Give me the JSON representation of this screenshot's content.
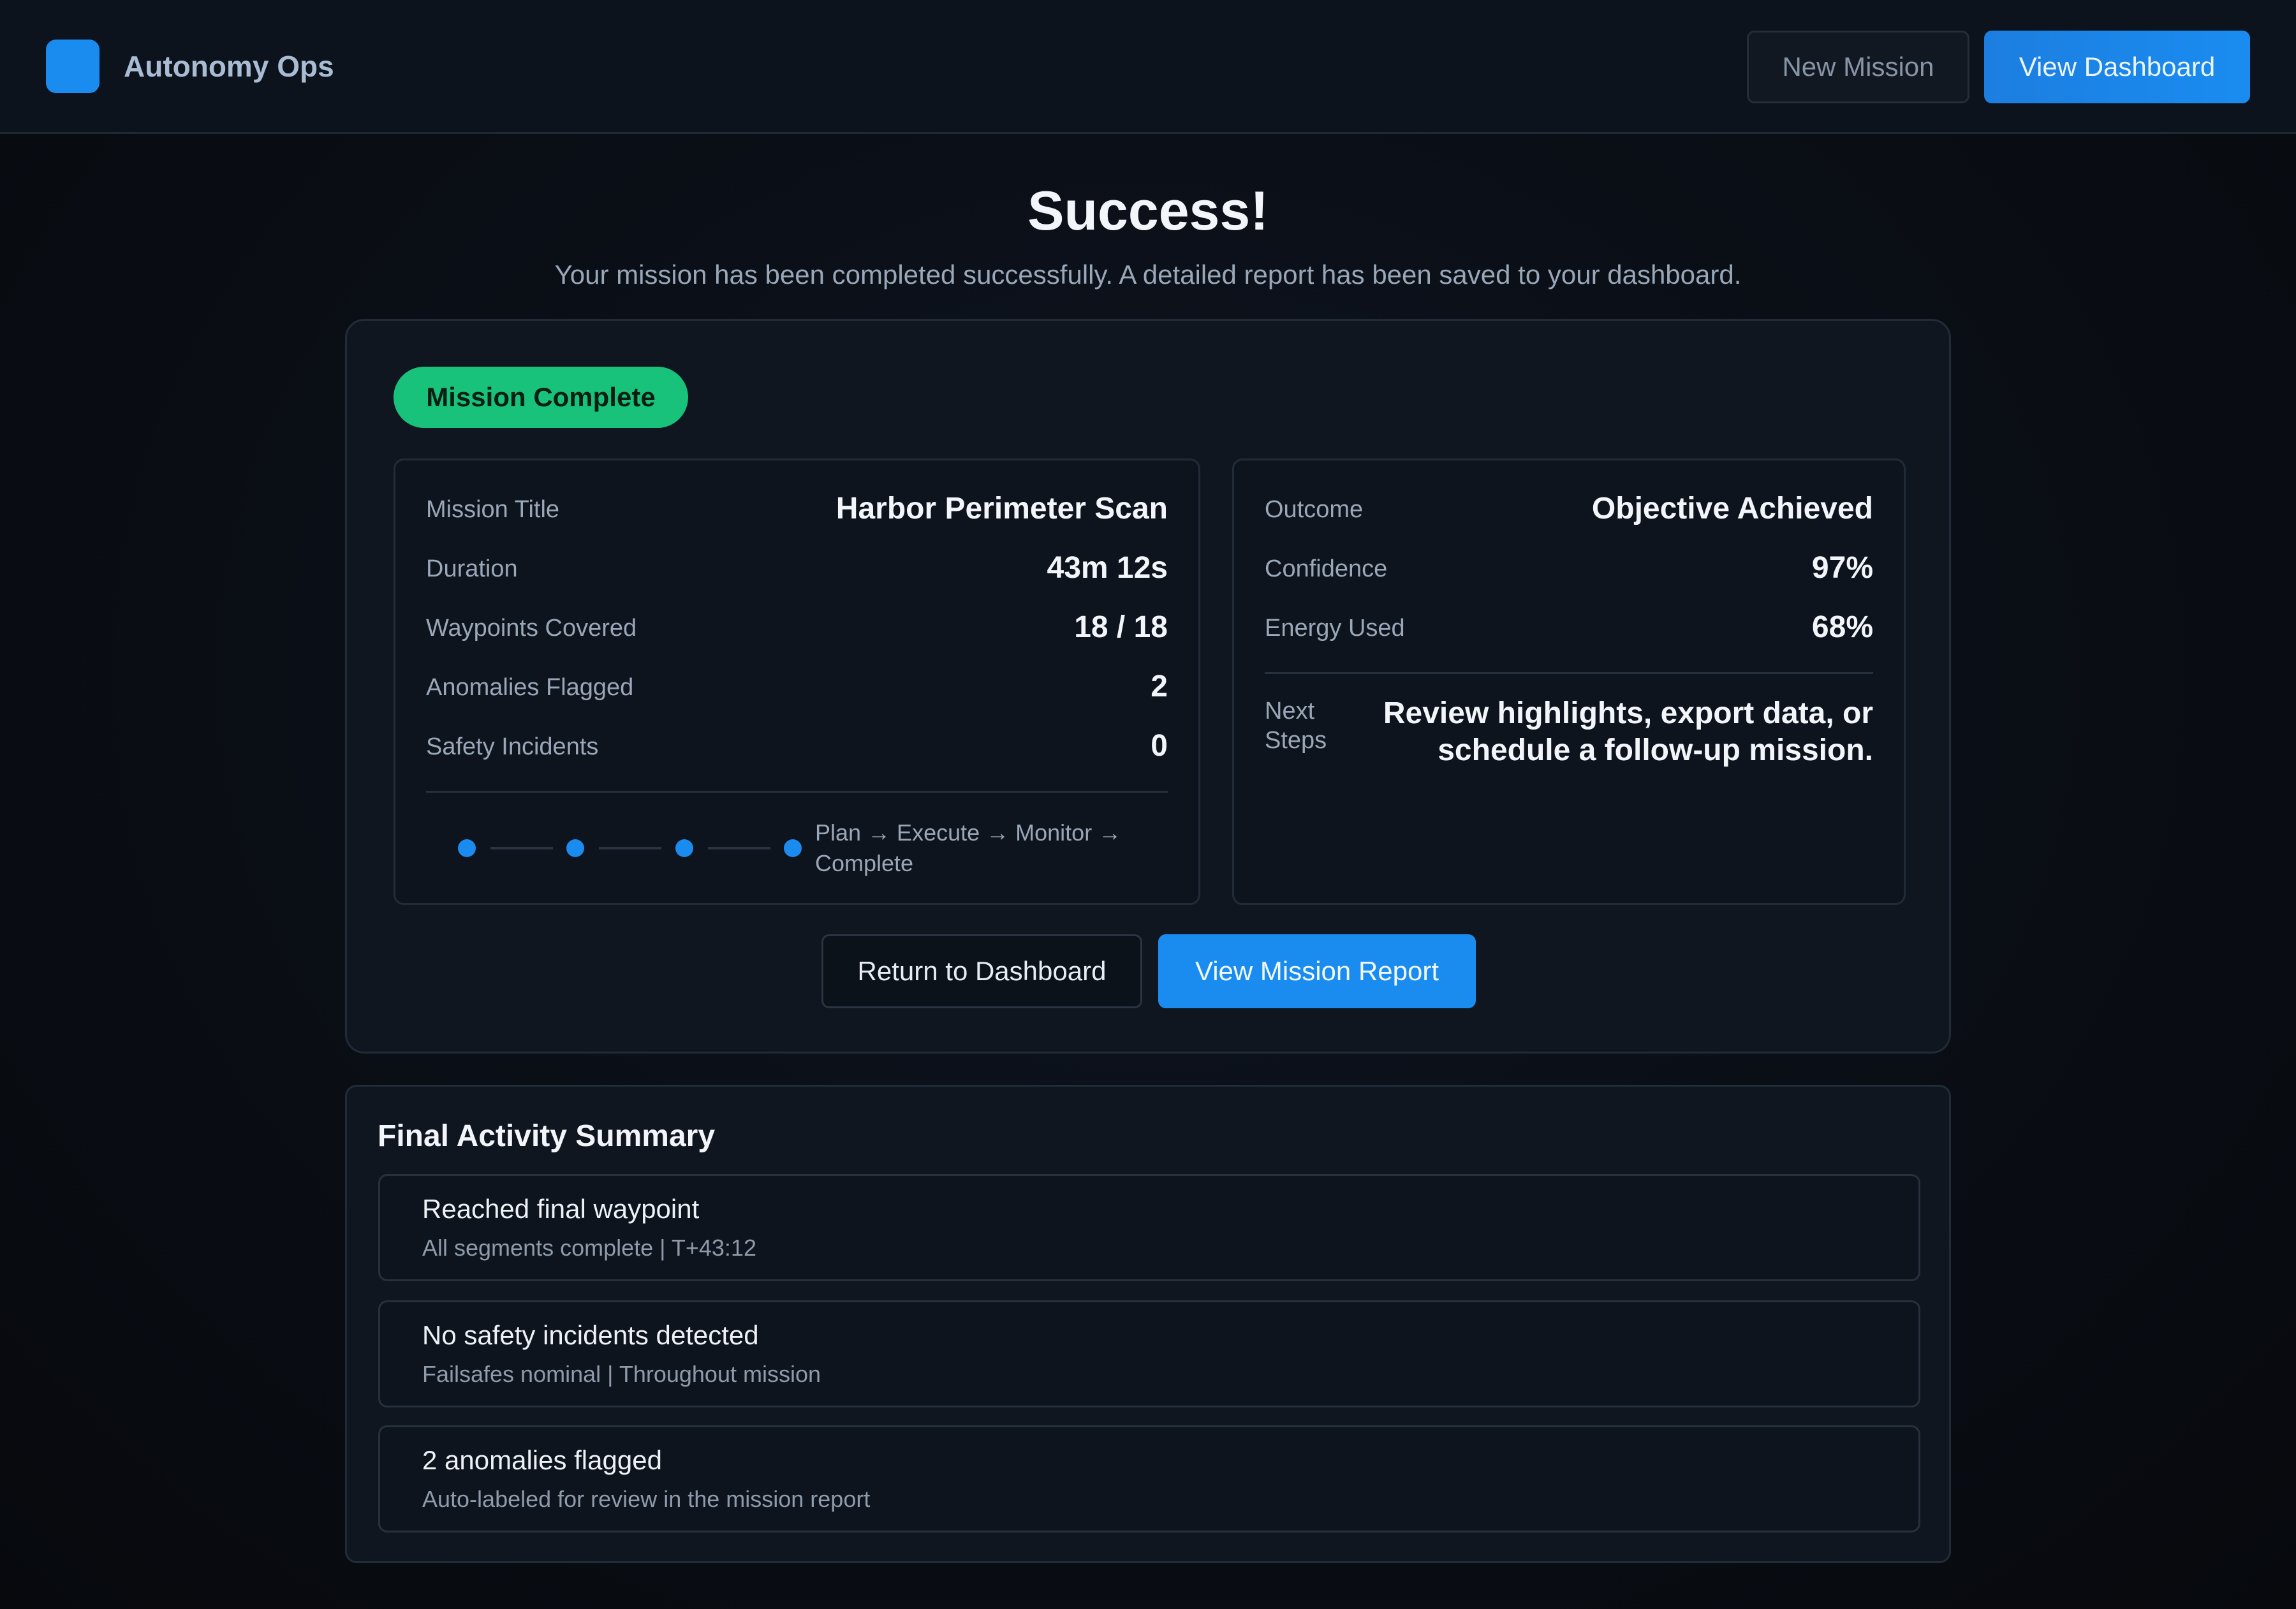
{
  "header": {
    "brand_name": "Autonomy Ops",
    "new_mission_label": "New Mission",
    "view_dashboard_label": "View Dashboard"
  },
  "hero": {
    "title": "Success!",
    "subtitle": "Your mission has been completed successfully. A detailed report has been saved to your dashboard."
  },
  "status": {
    "badge": "Mission Complete"
  },
  "mission": {
    "rows": [
      {
        "label": "Mission Title",
        "value": "Harbor Perimeter Scan"
      },
      {
        "label": "Duration",
        "value": "43m 12s"
      },
      {
        "label": "Waypoints Covered",
        "value": "18 / 18"
      },
      {
        "label": "Anomalies Flagged",
        "value": "2"
      },
      {
        "label": "Safety Incidents",
        "value": "0"
      }
    ],
    "stepper_text": "Plan → Execute → Monitor → Complete"
  },
  "outcome": {
    "rows": [
      {
        "label": "Outcome",
        "value": "Objective Achieved"
      },
      {
        "label": "Confidence",
        "value": "97%"
      },
      {
        "label": "Energy Used",
        "value": "68%"
      }
    ],
    "next_steps_label": "Next Steps",
    "next_steps_value": "Review highlights, export data, or schedule a follow-up mission."
  },
  "actions": {
    "return_label": "Return to Dashboard",
    "report_label": "View Mission Report"
  },
  "activity": {
    "title": "Final Activity Summary",
    "items": [
      {
        "title": "Reached final waypoint",
        "sub": "All segments complete | T+43:12"
      },
      {
        "title": "No safety incidents detected",
        "sub": "Failsafes nominal | Throughout mission"
      },
      {
        "title": "2 anomalies flagged",
        "sub": "Auto-labeled for review in the mission report"
      }
    ]
  },
  "colors": {
    "accent": "#1a8cf0",
    "success": "#19c27a",
    "background": "#0a0e15"
  }
}
